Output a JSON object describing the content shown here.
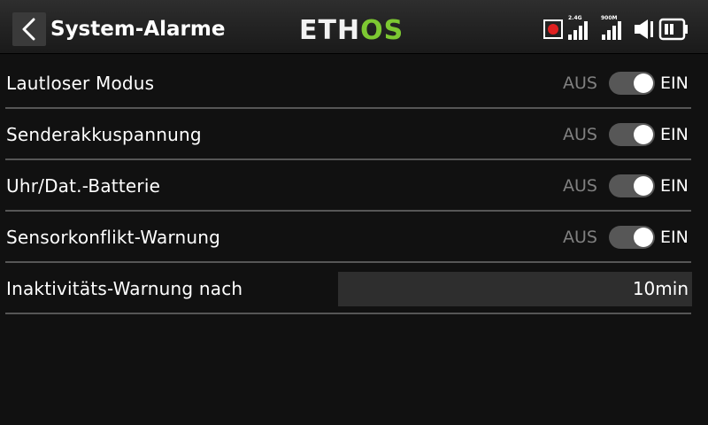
{
  "header": {
    "title": "System-Alarme",
    "brand": "ETHOS",
    "status": {
      "recording_color": "#e02020",
      "signal_24_label": "2.4G",
      "signal_900_label": "900M"
    }
  },
  "toggle_labels": {
    "off": "AUS",
    "on": "EIN"
  },
  "rows": [
    {
      "label": "Lautloser Modus",
      "state": "on"
    },
    {
      "label": "Senderakkuspannung",
      "state": "on"
    },
    {
      "label": "Uhr/Dat.-Batterie",
      "state": "on"
    },
    {
      "label": "Sensorkonflikt-Warnung",
      "state": "on"
    }
  ],
  "inactivity": {
    "label": "Inaktivitäts-Warnung nach",
    "value": "10min"
  },
  "colors": {
    "brand_green": "#7dc832",
    "switch_track": "#575757"
  }
}
